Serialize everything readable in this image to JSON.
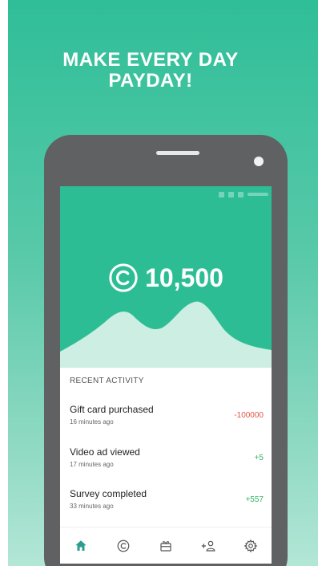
{
  "promo": {
    "headline_line1": "MAKE EVERY DAY",
    "headline_line2": "PAYDAY!"
  },
  "balance": {
    "value": "10,500",
    "icon": "coin-c-icon"
  },
  "activity": {
    "section_title": "RECENT ACTIVITY",
    "items": [
      {
        "title": "Gift card purchased",
        "time": "16 minutes ago",
        "amount": "-100000",
        "sign": "negative"
      },
      {
        "title": "Video ad viewed",
        "time": "17 minutes ago",
        "amount": "+5",
        "sign": "positive"
      },
      {
        "title": "Survey completed",
        "time": "33 minutes ago",
        "amount": "+557",
        "sign": "positive"
      }
    ]
  },
  "tabs": [
    {
      "id": "home",
      "icon": "home-icon",
      "active": true
    },
    {
      "id": "coins",
      "icon": "coin-icon",
      "active": false
    },
    {
      "id": "rewards",
      "icon": "gift-icon",
      "active": false
    },
    {
      "id": "invite",
      "icon": "add-user-icon",
      "active": false
    },
    {
      "id": "settings",
      "icon": "gear-icon",
      "active": false
    }
  ],
  "colors": {
    "brand": "#2dbd95",
    "active_tab": "#2a9d8f",
    "inactive_tab": "#555555",
    "negative": "#e25546",
    "positive": "#35b565"
  }
}
